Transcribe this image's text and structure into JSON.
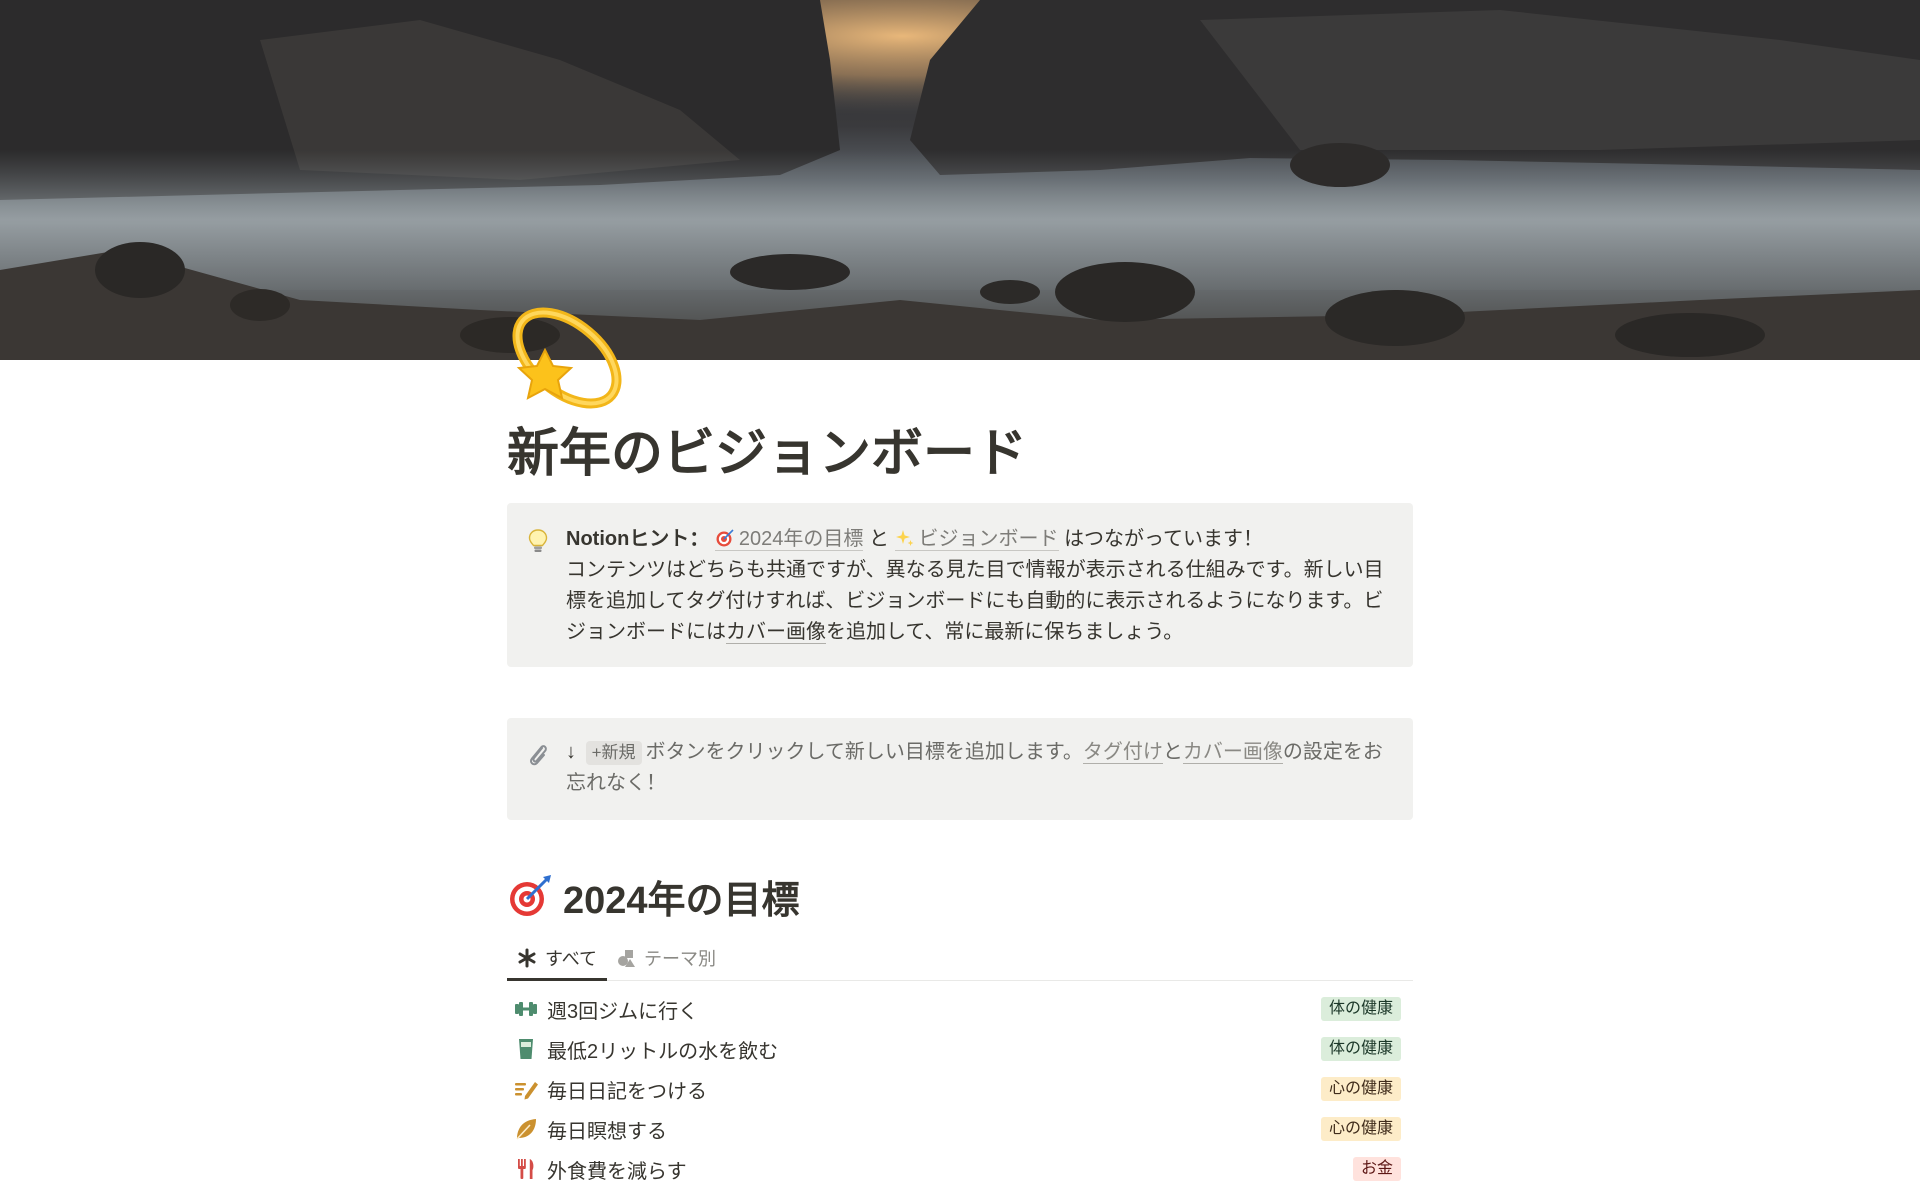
{
  "cover": {
    "alt": ""
  },
  "page": {
    "icon": "dizzy-star-icon",
    "title": "新年のビジョンボード"
  },
  "callout_hint": {
    "icon": "light-bulb-icon",
    "lead_bold": "Notionヒント：",
    "link1_icon": "target-icon",
    "link1_label": "2024年の目標",
    "connector": "と",
    "link2_icon": "sparkles-icon",
    "link2_label": "ビジョンボード",
    "tail": "はつながっています！",
    "body_before_link": "コンテンツはどちらも共通ですが、異なる見た目で情報が表示される仕組みです。新しい目標を追加してタグ付けすれば、ビジョンボードにも自動的に表示されるようになります。ビジョンボードには",
    "body_link": "カバー画像",
    "body_after_link": "を追加して、常に最新に保ちましょう。"
  },
  "callout_new": {
    "icon": "paperclip-icon",
    "arrow": "↓",
    "chip": "+新規",
    "text1": "ボタンをクリックして新しい目標を追加します。",
    "link1": "タグ付け",
    "text2": "と",
    "link2": "カバー画像",
    "text3": "の設定をお忘れなく！"
  },
  "section": {
    "icon": "target-icon",
    "heading": "2024年の目標"
  },
  "tabs": [
    {
      "label": "すべて",
      "icon": "asterisk-icon",
      "active": true
    },
    {
      "label": "テーマ別",
      "icon": "shapes-icon",
      "active": false
    }
  ],
  "goals": [
    {
      "label": "週3回ジムに行く",
      "icon": "dumbbell-icon",
      "tag": "体の健康",
      "tag_color": "green"
    },
    {
      "label": "最低2リットルの水を飲む",
      "icon": "glass-icon",
      "tag": "体の健康",
      "tag_color": "green"
    },
    {
      "label": "毎日日記をつける",
      "icon": "writing-icon",
      "tag": "心の健康",
      "tag_color": "yellow"
    },
    {
      "label": "毎日瞑想する",
      "icon": "leaf-icon",
      "tag": "心の健康",
      "tag_color": "yellow"
    },
    {
      "label": "外食費を減らす",
      "icon": "fork-knife-icon",
      "tag": "お金",
      "tag_color": "red"
    }
  ]
}
